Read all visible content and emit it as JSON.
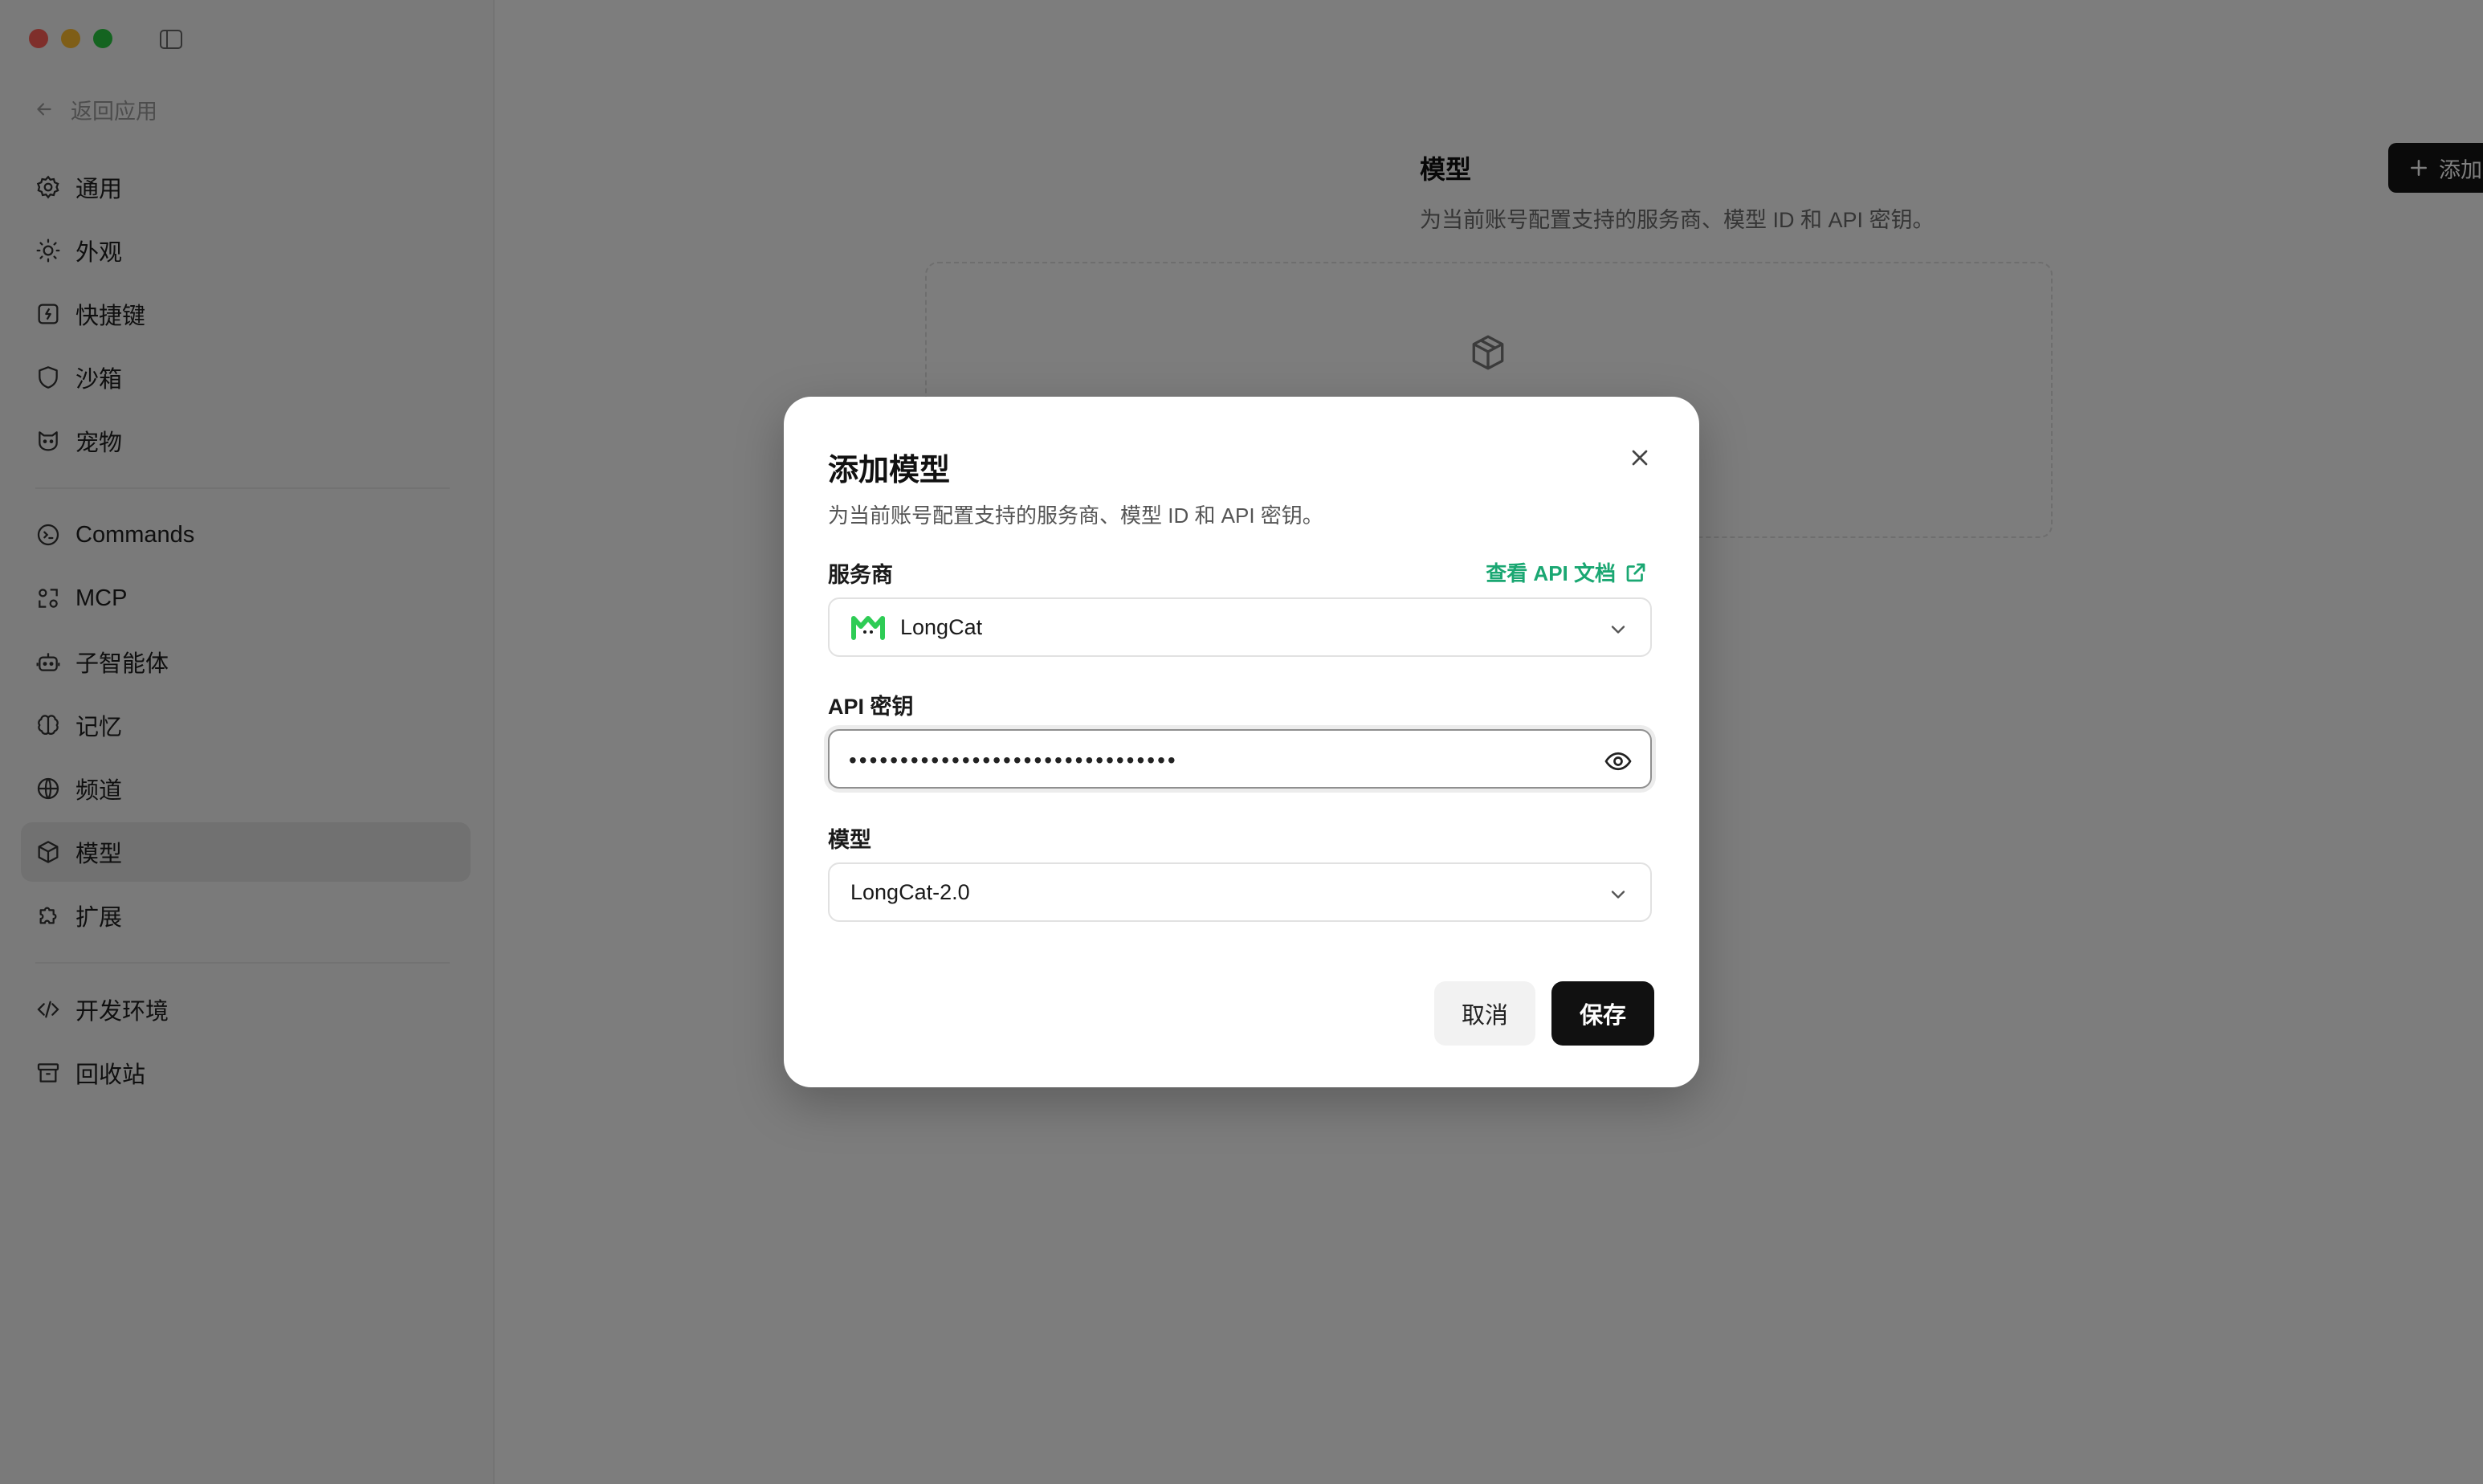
{
  "sidebar": {
    "back_label": "返回应用",
    "items": [
      {
        "label": "通用",
        "icon": "gear-icon"
      },
      {
        "label": "外观",
        "icon": "sun-icon"
      },
      {
        "label": "快捷键",
        "icon": "shortcut-icon"
      },
      {
        "label": "沙箱",
        "icon": "shield-icon"
      },
      {
        "label": "宠物",
        "icon": "cat-icon"
      },
      {
        "label": "Commands",
        "icon": "terminal-icon"
      },
      {
        "label": "MCP",
        "icon": "mcp-icon"
      },
      {
        "label": "子智能体",
        "icon": "robot-icon"
      },
      {
        "label": "记忆",
        "icon": "brain-icon"
      },
      {
        "label": "频道",
        "icon": "globe-icon"
      },
      {
        "label": "模型",
        "icon": "cube-icon",
        "active": true
      },
      {
        "label": "扩展",
        "icon": "puzzle-icon"
      },
      {
        "label": "开发环境",
        "icon": "code-icon"
      },
      {
        "label": "回收站",
        "icon": "archive-icon"
      }
    ]
  },
  "content": {
    "title": "模型",
    "subtitle": "为当前账号配置支持的服务商、模型 ID 和 API 密钥。",
    "add_button": "添加模型"
  },
  "modal": {
    "title": "添加模型",
    "description": "为当前账号配置支持的服务商、模型 ID 和 API 密钥。",
    "provider_label": "服务商",
    "docs_link": "查看 API 文档",
    "provider_value": "LongCat",
    "api_key_label": "API 密钥",
    "api_key_masked": "••••••••••••••••••••••••••••••••",
    "model_label": "模型",
    "model_value": "LongCat-2.0",
    "cancel": "取消",
    "save": "保存"
  },
  "colors": {
    "accent_link": "#1aa772",
    "primary_button": "#111111",
    "longcat_logo": "#2ecc55"
  }
}
